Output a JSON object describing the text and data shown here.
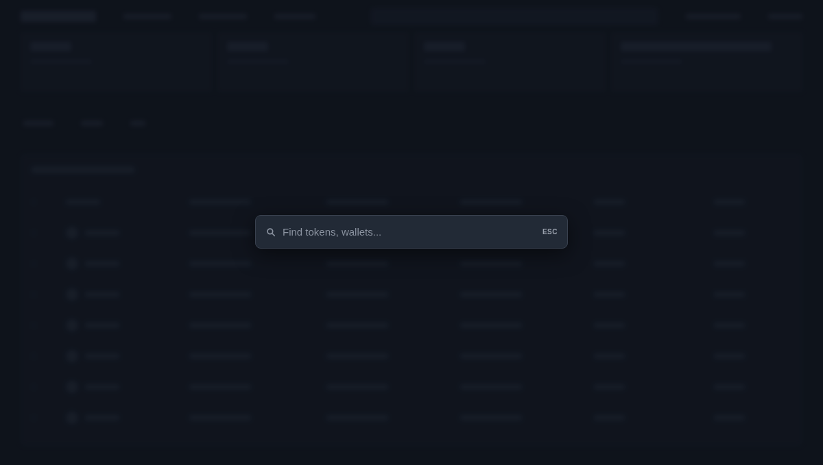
{
  "search": {
    "placeholder": "Find tokens, wallets...",
    "shortcut": "ESC"
  }
}
